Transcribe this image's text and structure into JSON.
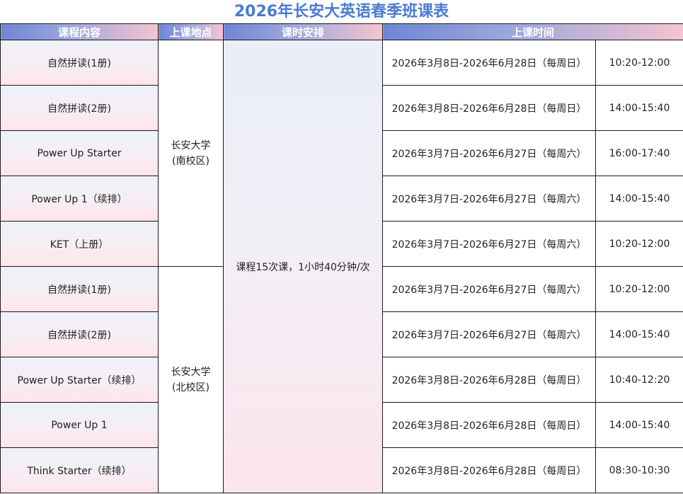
{
  "title": "2026年长安大英语春季班课表",
  "headers": {
    "course": "课程内容",
    "location": "上课地点",
    "schedule": "课时安排",
    "time": "上课时间"
  },
  "locations": {
    "south": [
      "长安大学",
      "(南校区)"
    ],
    "north": [
      "长安大学",
      "(北校区)"
    ]
  },
  "schedule_note": "课程15次课，1小时40分钟/次",
  "rows": [
    {
      "course": "自然拼读(1册)",
      "dates": "2026年3月8日-2026年6月28日（每周日）",
      "time": "10:20-12:00"
    },
    {
      "course": "自然拼读(2册)",
      "dates": "2026年3月8日-2026年6月28日（每周日）",
      "time": "14:00-15:40"
    },
    {
      "course": "Power Up Starter",
      "dates": "2026年3月7日-2026年6月27日（每周六）",
      "time": "16:00-17:40"
    },
    {
      "course": "Power Up 1（续排）",
      "dates": "2026年3月7日-2026年6月27日（每周六）",
      "time": "14:00-15:40"
    },
    {
      "course": "KET（上册）",
      "dates": "2026年3月7日-2026年6月27日（每周六）",
      "time": "10:20-12:00"
    },
    {
      "course": "自然拼读(1册)",
      "dates": "2026年3月7日-2026年6月27日（每周六）",
      "time": "10:20-12:00"
    },
    {
      "course": "自然拼读(2册)",
      "dates": "2026年3月7日-2026年6月27日（每周六）",
      "time": "14:00-15:40"
    },
    {
      "course": "Power Up Starter（续排）",
      "dates": "2026年3月8日-2026年6月28日（每周日）",
      "time": "10:40-12:20"
    },
    {
      "course": "Power Up 1",
      "dates": "2026年3月8日-2026年6月28日（每周日）",
      "time": "14:00-15:40"
    },
    {
      "course": "Think Starter（续排）",
      "dates": "2026年3月8日-2026年6月28日（每周日）",
      "time": "08:30-10:30"
    }
  ]
}
